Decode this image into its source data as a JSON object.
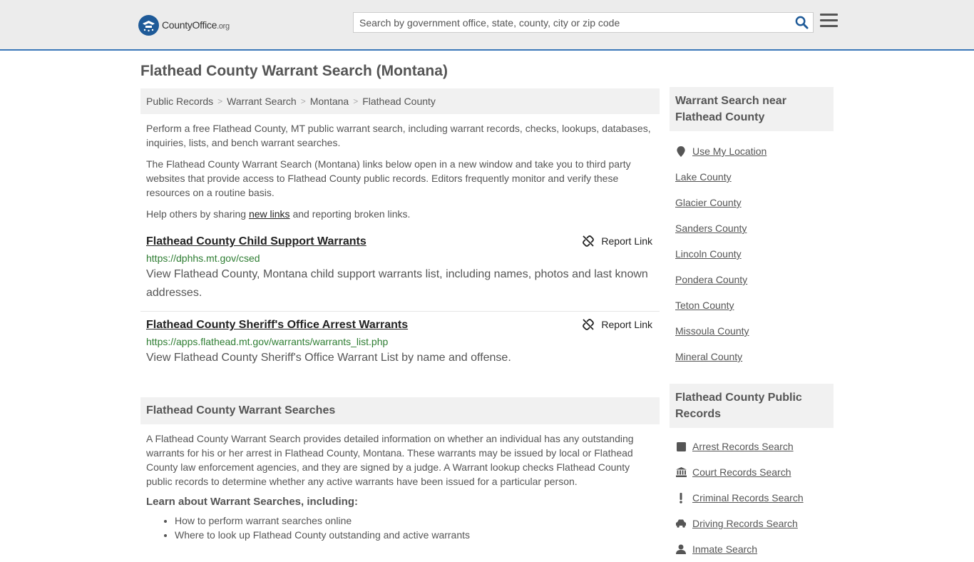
{
  "header": {
    "logo_text_main": "CountyOffice",
    "logo_text_org": ".org",
    "search_placeholder": "Search by government office, state, county, city or zip code"
  },
  "page_title": "Flathead County Warrant Search (Montana)",
  "breadcrumb": [
    "Public Records",
    "Warrant Search",
    "Montana",
    "Flathead County"
  ],
  "intro": {
    "p1": "Perform a free Flathead County, MT public warrant search, including warrant records, checks, lookups, databases, inquiries, lists, and bench warrant searches.",
    "p2": "The Flathead County Warrant Search (Montana) links below open in a new window and take you to third party websites that provide access to Flathead County public records. Editors frequently monitor and verify these resources on a routine basis.",
    "p3_before": "Help others by sharing ",
    "p3_link": "new links",
    "p3_after": " and reporting broken links."
  },
  "results": [
    {
      "title": "Flathead County Child Support Warrants",
      "url": "https://dphhs.mt.gov/csed",
      "desc": "View Flathead County, Montana child support warrants list, including names, photos and last known addresses.",
      "report": "Report Link"
    },
    {
      "title": "Flathead County Sheriff's Office Arrest Warrants",
      "url": "https://apps.flathead.mt.gov/warrants/warrants_list.php",
      "desc": "View Flathead County Sheriff's Office Warrant List by name and offense.",
      "report": "Report Link"
    }
  ],
  "section": {
    "title": "Flathead County Warrant Searches",
    "body": "A Flathead County Warrant Search provides detailed information on whether an individual has any outstanding warrants for his or her arrest in Flathead County, Montana. These warrants may be issued by local or Flathead County law enforcement agencies, and they are signed by a judge. A Warrant lookup checks Flathead County public records to determine whether any active warrants have been issued for a particular person.",
    "learn": "Learn about Warrant Searches, including:",
    "bullets": [
      "How to perform warrant searches online",
      "Where to look up Flathead County outstanding and active warrants"
    ]
  },
  "sidebar": {
    "nearby_title": "Warrant Search near Flathead County",
    "location_label": "Use My Location",
    "counties": [
      "Lake County",
      "Glacier County",
      "Sanders County",
      "Lincoln County",
      "Pondera County",
      "Teton County",
      "Missoula County",
      "Mineral County"
    ],
    "records_title": "Flathead County Public Records",
    "records": [
      {
        "label": "Arrest Records Search",
        "icon": "square-icon"
      },
      {
        "label": "Court Records Search",
        "icon": "courthouse-icon"
      },
      {
        "label": "Criminal Records Search",
        "icon": "exclamation-icon"
      },
      {
        "label": "Driving Records Search",
        "icon": "car-icon"
      },
      {
        "label": "Inmate Search",
        "icon": "inmate-icon"
      }
    ]
  },
  "colors": {
    "accent": "#3a78b8",
    "url_green": "#2e7d32",
    "panel_bg": "#f1f1f1"
  }
}
